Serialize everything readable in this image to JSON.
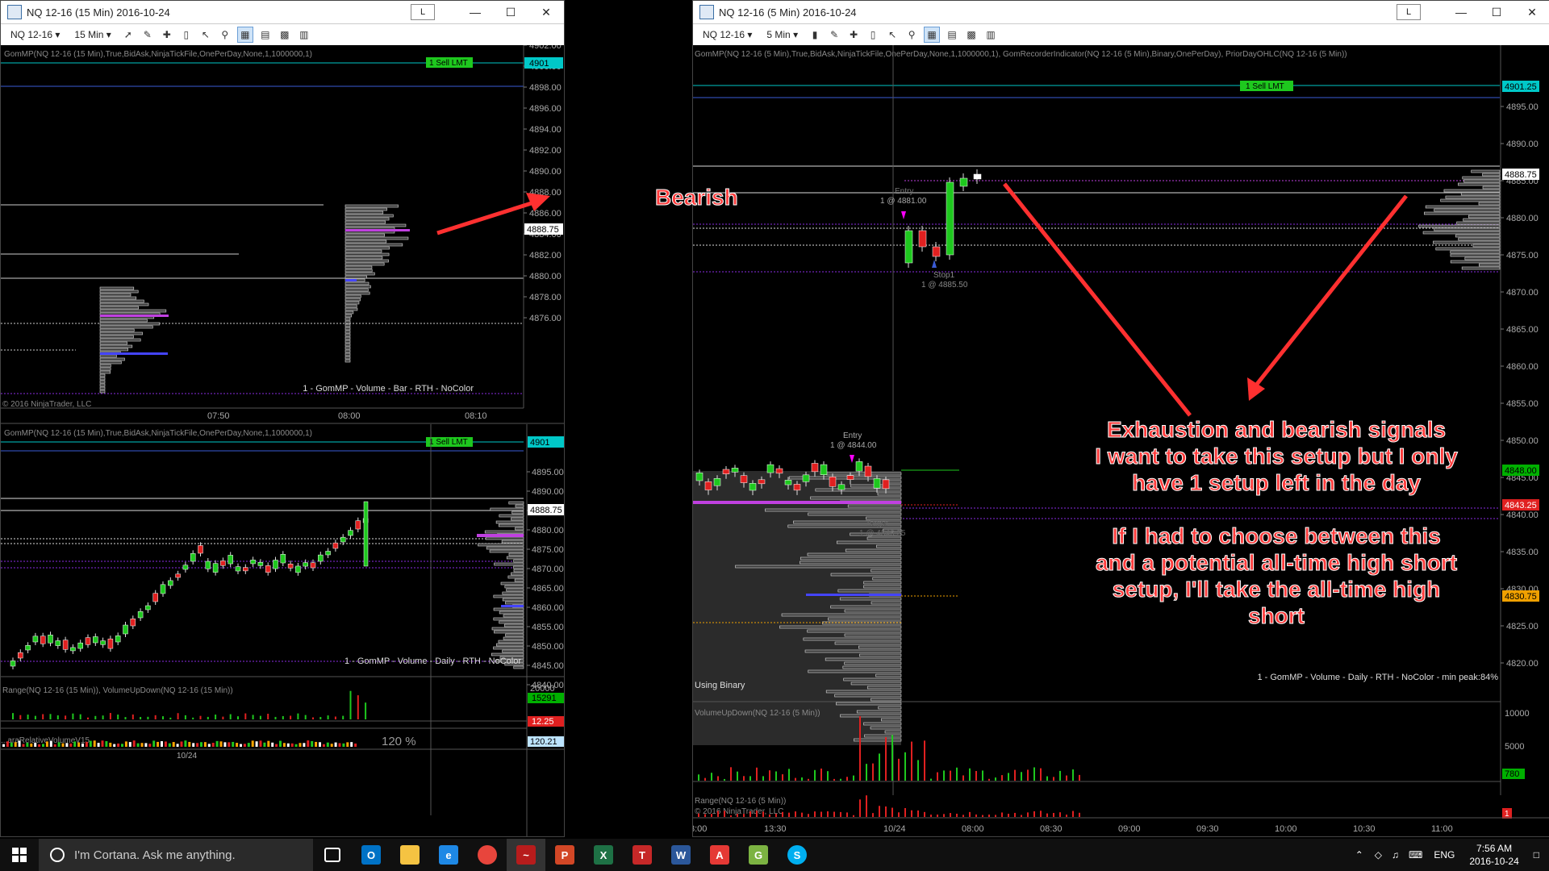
{
  "left_window": {
    "title": "NQ 12-16 (15 Min)  2016-10-24",
    "instrument": "NQ 12-16",
    "interval": "15 Min",
    "link_label": "L",
    "top_panel": {
      "indicator": "GomMP(NQ 12-16 (15 Min),True,BidAsk,NinjaTickFile,OnePerDay,None,1,1000000,1)",
      "order_label": "1  Sell LMT",
      "order_price": "4901",
      "current_price": "4888.75",
      "price_ticks": [
        "4902.00",
        "4900.00",
        "4898.00",
        "4896.00",
        "4894.00",
        "4892.00",
        "4890.00",
        "4888.00",
        "4886.00",
        "4884.00",
        "4882.00",
        "4880.00",
        "4878.00",
        "4876.00"
      ],
      "time_ticks": [
        "07:50",
        "08:00",
        "08:10"
      ],
      "legend": "1 - GomMP  - Volume - Bar - RTH - NoColor",
      "copyright": "© 2016 NinjaTrader, LLC"
    },
    "bottom_panel": {
      "indicator": "GomMP(NQ 12-16 (15 Min),True,BidAsk,NinjaTickFile,OnePerDay,None,1,1000000,1)",
      "order_label": "1  Sell LMT",
      "order_price": "4901",
      "current_price": "4888.75",
      "price_ticks": [
        "4895.00",
        "4890.00",
        "4885.00",
        "4880.00",
        "4875.00",
        "4870.00",
        "4865.00",
        "4860.00",
        "4855.00",
        "4850.00",
        "4845.00",
        "4840.00"
      ],
      "legend": "1 - GomMP  - Volume - Daily - RTH - NoColor",
      "volume_indicator": "Range(NQ 12-16 (15 Min)), VolumeUpDown(NQ 12-16 (15 Min))",
      "volume_ticks": [
        "20000"
      ],
      "volume_badge": "15291",
      "range_badge": "12.25",
      "relvol_label": "...araRelativeVolumeV15",
      "relvol_pct": "120 %",
      "relvol_badge": "120.21",
      "date_label": "10/24"
    }
  },
  "right_window": {
    "title": "NQ 12-16 (5 Min)  2016-10-24",
    "instrument": "NQ 12-16",
    "interval": "5 Min",
    "link_label": "L",
    "indicator": "GomMP(NQ 12-16 (5 Min),True,BidAsk,NinjaTickFile,OnePerDay,None,1,1000000,1), GomRecorderIndicator(NQ 12-16 (5 Min),Binary,OnePerDay), PriorDayOHLC(NQ 12-16 (5 Min))",
    "order_label": "1  Sell LMT",
    "order_price": "4901.25",
    "current_price": "4888.75",
    "price_ticks": [
      "4895.00",
      "4890.00",
      "4885.00",
      "4880.00",
      "4875.00",
      "4870.00",
      "4865.00",
      "4860.00",
      "4855.00",
      "4850.00",
      "4845.00",
      "4840.00",
      "4835.00",
      "4830.00",
      "4825.00",
      "4820.00"
    ],
    "badges": [
      "4848.00",
      "4843.25",
      "4830.75"
    ],
    "entry1_label": "Entry",
    "entry1_price": "1 @ 4881.00",
    "stop1_label": "Stop1",
    "stop1_price": "1 @ 4885.50",
    "entry2_label": "Entry",
    "entry2_price": "1 @ 4844.00",
    "target_label": "Target",
    "target_price": "1 @ 4846.25",
    "using_binary": "Using Binary",
    "legend": "1 - GomMP  - Volume - Daily - RTH - NoColor - min peak:84%",
    "volume_indicator": "VolumeUpDown(NQ 12-16 (5 Min))",
    "volume_ticks": [
      "10000",
      "5000"
    ],
    "volume_badge": "780",
    "range_indicator": "Range(NQ 12-16 (5 Min))",
    "range_badge": "1",
    "copyright": "© 2016 NinjaTrader, LLC",
    "time_ticks": [
      "3:00",
      "13:30",
      "10/24",
      "08:00",
      "08:30",
      "09:00",
      "09:30",
      "10:00",
      "10:30",
      "11:00"
    ]
  },
  "annotations": {
    "bearish": "Bearish",
    "note1": [
      "Exhaustion and bearish signals",
      "I want to take this setup but I only",
      "have 1 setup left in the day"
    ],
    "note2": [
      "If I had to choose between this",
      "and a potential all-time high short",
      "setup, I'll take the all-time high",
      "short"
    ]
  },
  "taskbar": {
    "search_placeholder": "I'm Cortana. Ask me anything.",
    "language": "ENG",
    "time": "7:56 AM",
    "date": "2016-10-24"
  },
  "colors": {
    "annotation_red": "#ff3b3b",
    "order_green": "#1ec81e",
    "price_line": "#3a5bd6",
    "poc_magenta": "#c040e0",
    "badge_green": "#00b000",
    "badge_red": "#e02020",
    "badge_orange": "#f0a000"
  }
}
